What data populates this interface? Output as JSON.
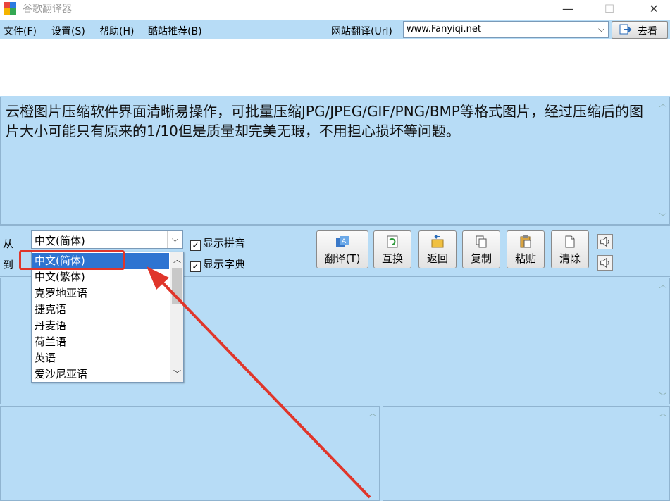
{
  "window": {
    "title": "谷歌翻译器",
    "minimize_glyph": "—",
    "maximize_glyph": "☐",
    "close_glyph": "✕"
  },
  "menu": {
    "items": [
      "文件(F)",
      "设置(S)",
      "帮助(H)",
      "酷站推荐(B)"
    ],
    "url_label": "网站翻译(Url)",
    "url_value": "www.Fanyiqi.net",
    "go_label": "去看"
  },
  "source_text": "云橙图片压缩软件界面清晰易操作，可批量压缩JPG/JPEG/GIF/PNG/BMP等格式图片，经过压缩后的图片大小可能只有原来的1/10但是质量却完美无瑕，不用担心损坏等问题。",
  "controls": {
    "from_label": "从",
    "to_label": "到",
    "from_value": "中文(简体)",
    "show_pinyin": "显示拼音",
    "show_dict": "显示字典",
    "buttons": [
      "翻译(T)",
      "互换",
      "返回",
      "复制",
      "粘贴",
      "清除"
    ]
  },
  "dropdown": {
    "options": [
      "中文(简体)",
      "中文(繁体)",
      "克罗地亚语",
      "捷克语",
      "丹麦语",
      "荷兰语",
      "英语",
      "爱沙尼亚语"
    ],
    "selected_index": 0
  },
  "colors": {
    "panel_bg": "#b7dcf6",
    "selection": "#2e74d1",
    "annotation": "#e0362b"
  }
}
